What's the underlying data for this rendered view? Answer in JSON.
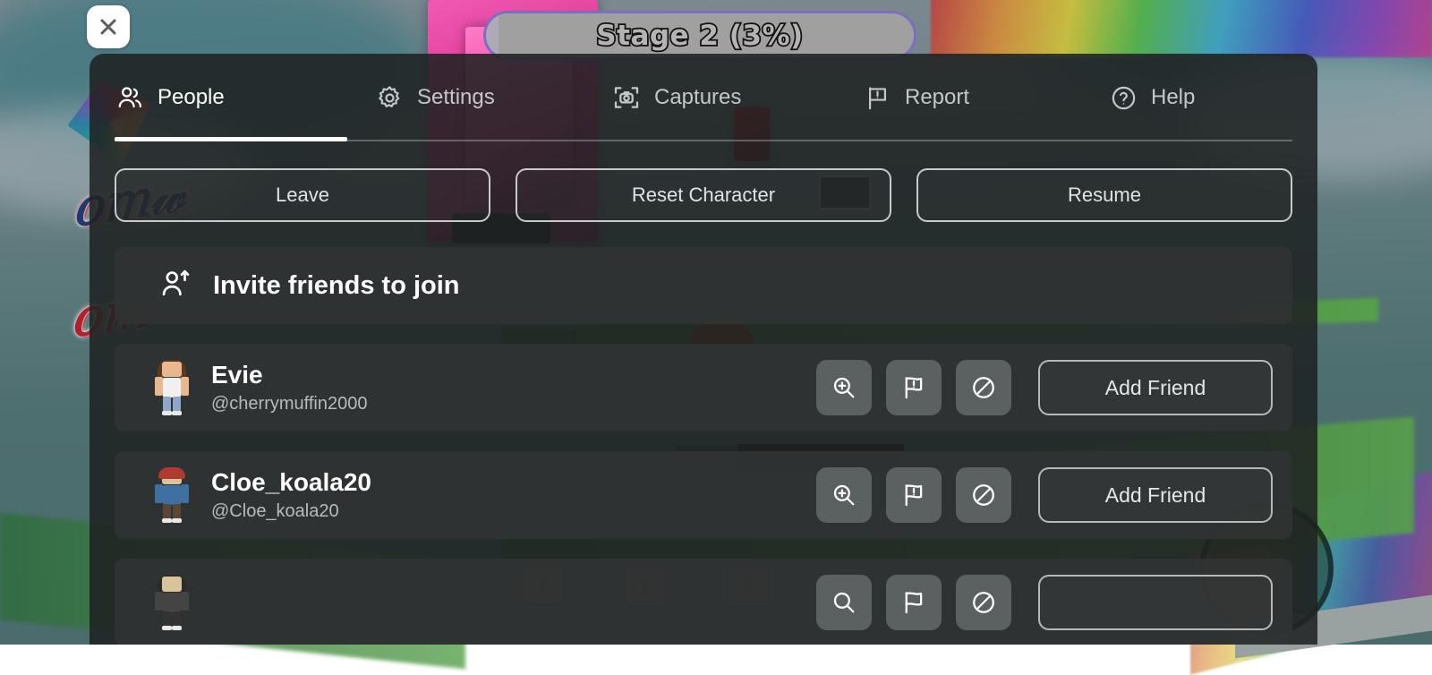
{
  "hud": {
    "stage_label": "Stage 2 (3%)",
    "stage_progress_percent": 3,
    "close_icon": "close-icon"
  },
  "menu": {
    "tabs": [
      {
        "label": "People",
        "icon": "people-icon",
        "active": true
      },
      {
        "label": "Settings",
        "icon": "gear-icon",
        "active": false
      },
      {
        "label": "Captures",
        "icon": "camera-icon",
        "active": false
      },
      {
        "label": "Report",
        "icon": "flag-icon",
        "active": false
      },
      {
        "label": "Help",
        "icon": "question-icon",
        "active": false
      }
    ],
    "actions": [
      {
        "label": "Leave"
      },
      {
        "label": "Reset Character"
      },
      {
        "label": "Resume"
      }
    ],
    "invite": {
      "label": "Invite friends to join",
      "icon": "person-add-icon"
    },
    "players": [
      {
        "display_name": "Evie",
        "handle": "@cherrymuffin2000",
        "add_friend_label": "Add Friend",
        "actions": [
          "inspect-icon",
          "report-flag-icon",
          "block-icon"
        ],
        "avatar": {
          "skin": "#e8b98e",
          "hair": "#5a3a22",
          "hat": null,
          "shirt": "#f0f0f0",
          "pants": "#8fa6c6"
        }
      },
      {
        "display_name": "Cloe_koala20",
        "handle": "@Cloe_koala20",
        "add_friend_label": "Add Friend",
        "actions": [
          "inspect-icon",
          "report-flag-icon",
          "block-icon"
        ],
        "avatar": {
          "skin": "#d9c49a",
          "hair": "#3a2a20",
          "hat": "#b03a2e",
          "shirt": "#3f6fa3",
          "pants": "#5a4632"
        }
      },
      {
        "display_name": "",
        "handle": "",
        "add_friend_label": "",
        "actions": [
          "inspect-icon",
          "report-flag-icon",
          "block-icon"
        ],
        "avatar": {
          "skin": "#d9c49a",
          "hair": "#2b2b2b",
          "hat": null,
          "shirt": "#444",
          "pants": "#333"
        }
      }
    ]
  },
  "colors": {
    "panel_bg": "#1f2222",
    "row_bg": "#303333",
    "accent_white": "#ffffff",
    "muted_text": "#b6bbbd",
    "pill_border": "#7b6fc4",
    "pill_bg": "#a0a0a0"
  }
}
